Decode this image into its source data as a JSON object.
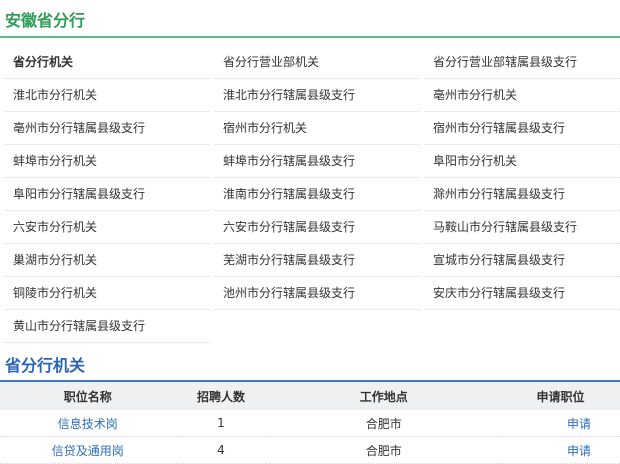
{
  "section": {
    "title": "安徽省分行"
  },
  "branches": [
    "省分行机关",
    "省分行营业部机关",
    "省分行营业部辖属县级支行",
    "淮北市分行机关",
    "淮北市分行辖属县级支行",
    "亳州市分行机关",
    "亳州市分行辖属县级支行",
    "宿州市分行机关",
    "宿州市分行辖属县级支行",
    "蚌埠市分行机关",
    "蚌埠市分行辖属县级支行",
    "阜阳市分行机关",
    "阜阳市分行辖属县级支行",
    "淮南市分行辖属县级支行",
    "滁州市分行辖属县级支行",
    "六安市分行机关",
    "六安市分行辖属县级支行",
    "马鞍山市分行辖属县级支行",
    "巢湖市分行机关",
    "芜湖市分行辖属县级支行",
    "宣城市分行辖属县级支行",
    "铜陵市分行机关",
    "池州市分行辖属县级支行",
    "安庆市分行辖属县级支行",
    "黄山市分行辖属县级支行"
  ],
  "jobs_section": {
    "title": "省分行机关",
    "headers": [
      "职位名称",
      "招聘人数",
      "工作地点",
      "申请职位"
    ],
    "rows": [
      {
        "name": "信息技术岗",
        "count": "1",
        "location": "合肥市",
        "apply": "申请"
      },
      {
        "name": "信贷及通用岗",
        "count": "4",
        "location": "合肥市",
        "apply": "申请"
      }
    ]
  }
}
